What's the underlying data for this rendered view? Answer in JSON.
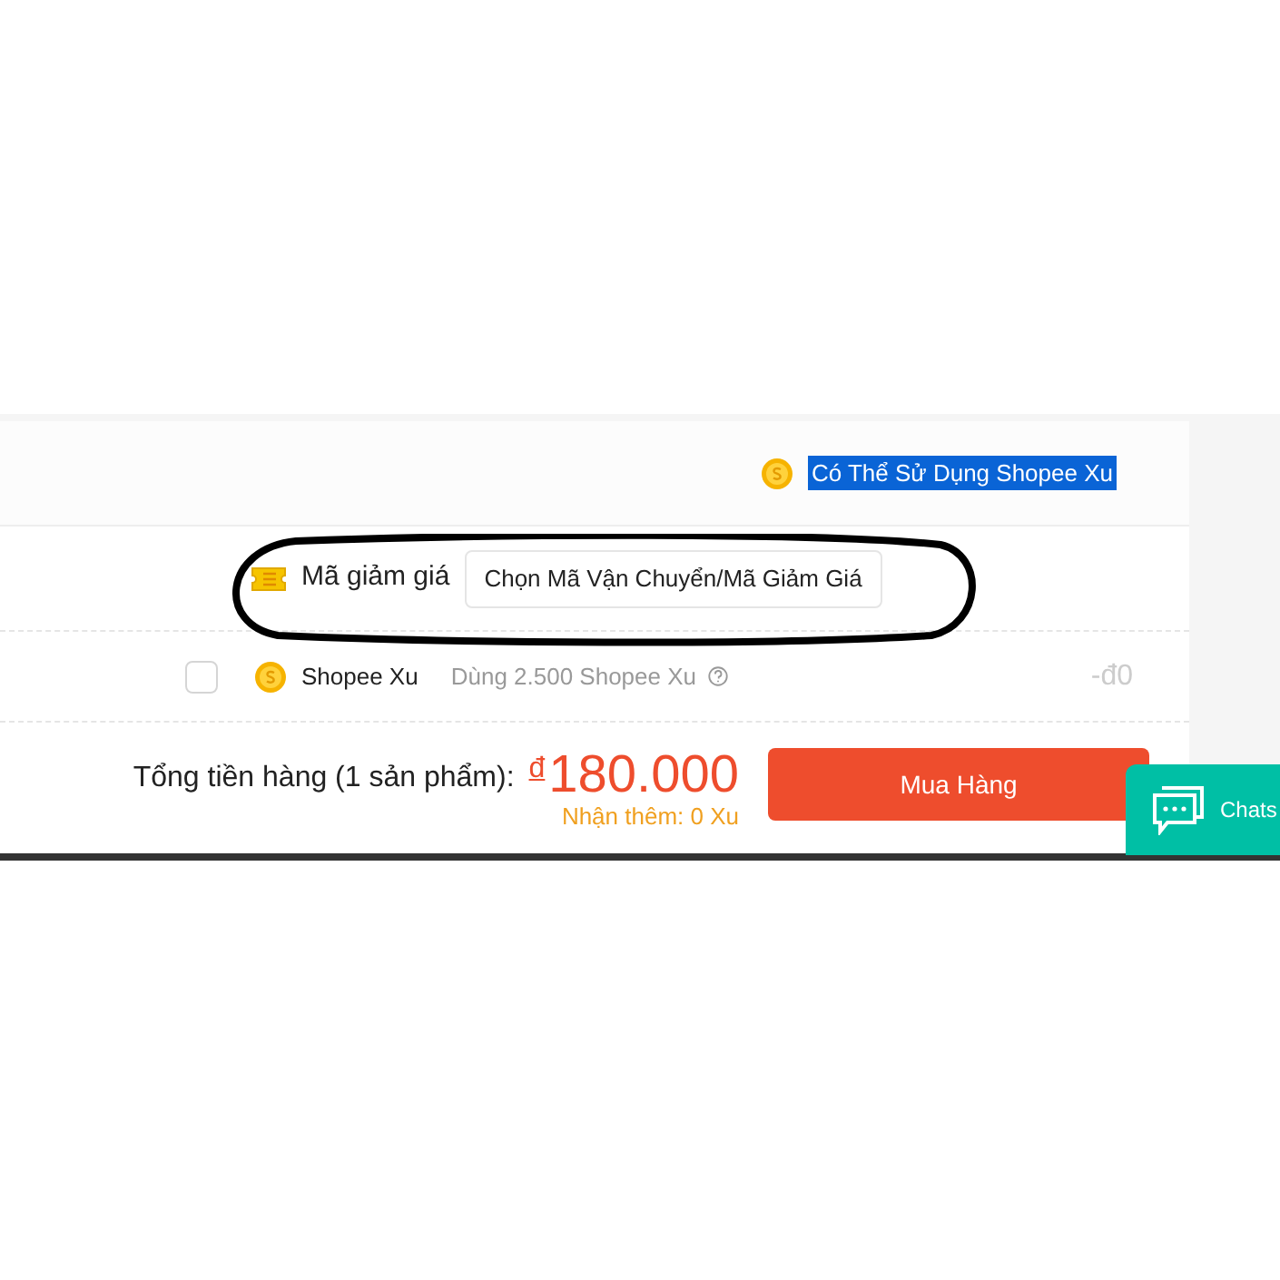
{
  "shopee_xu_notice": {
    "text": "Có Thể Sử Dụng Shopee Xu",
    "highlighted": true
  },
  "voucher": {
    "label": "Mã giảm giá",
    "button": "Chọn Mã Vận Chuyển/Mã Giảm Giá"
  },
  "xu_row": {
    "checked": false,
    "label": "Shopee Xu",
    "detail": "Dùng 2.500 Shopee Xu",
    "amount": "-đ0"
  },
  "total": {
    "label": "Tổng tiền hàng (1 sản phẩm):",
    "currency": "đ",
    "amount": "180.000",
    "bonus": "Nhận thêm: 0 Xu"
  },
  "buy_button": "Mua Hàng",
  "chat_button": "Chats"
}
